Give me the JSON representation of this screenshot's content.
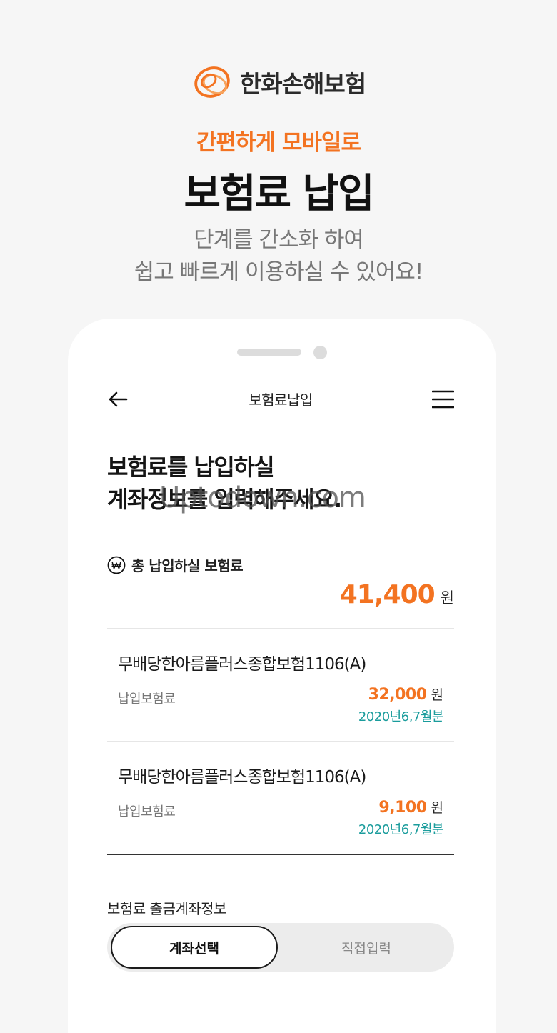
{
  "brand": {
    "logo_text": "한화손해보험",
    "accent_color": "#f37321"
  },
  "promo": {
    "tagline": "간편하게 모바일로",
    "headline": "보험료 납입",
    "desc_line1": "단계를 간소화 하여",
    "desc_line2": "쉽고 빠르게 이용하실 수 있어요!"
  },
  "app": {
    "header_title": "보험료납입",
    "title_line1": "보험료를 납입하실",
    "title_line2": "계좌정보를 입력해주세요.",
    "watermark": "Uptodown.com",
    "total_label": "총 납입하실 보험료",
    "total_value": "41,400",
    "unit": "원",
    "items": [
      {
        "name": "무배당한아름플러스종합보험1106(A)",
        "label": "납입보험료",
        "value": "32,000",
        "unit": "원",
        "period": "2020년6,7월분"
      },
      {
        "name": "무배당한아름플러스종합보험1106(A)",
        "label": "납입보험료",
        "value": "9,100",
        "unit": "원",
        "period": "2020년6,7월분"
      }
    ],
    "account_label": "보험료 출금계좌정보",
    "toggle": {
      "selected": "계좌선택",
      "other": "직접입력"
    }
  },
  "icons": [
    "hanwha-logo-icon",
    "arrow-left-icon",
    "hamburger-menu-icon",
    "won-circle-icon"
  ],
  "colors": {
    "orange": "#f37321",
    "teal": "#1a9c9c",
    "background": "#f6f6f6"
  }
}
